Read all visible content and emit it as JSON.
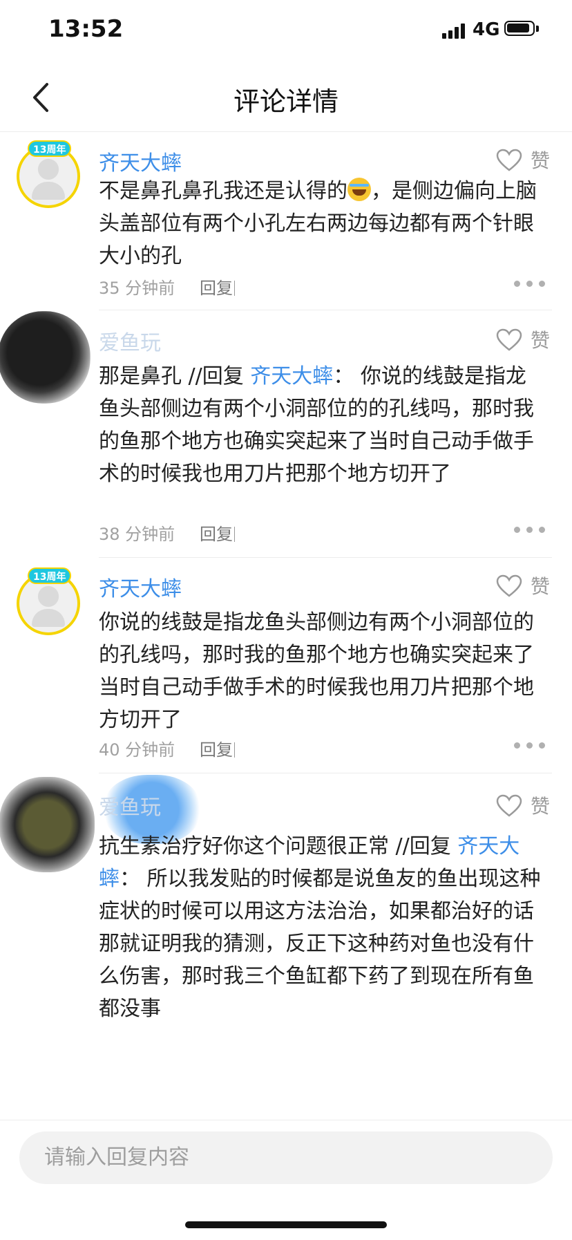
{
  "status_bar": {
    "time": "13:52",
    "network": "4G"
  },
  "nav": {
    "title": "评论详情",
    "back_icon": "chevron-left-icon"
  },
  "comments": [
    {
      "username": "齐天大蟀",
      "badge": "13周年",
      "content_before_emoji": "不是鼻孔鼻孔我还是认得的",
      "emoji": "tears-of-joy-emoji",
      "content_after_emoji": "，是侧边偏向上脑头盖部位有两个小孔左右两边每边都有两个针眼大小的孔",
      "time": "35 分钟前",
      "reply_label": "回复",
      "like_label": "赞"
    },
    {
      "username": "爱鱼玩",
      "content": "那是鼻孔 //回复 ",
      "mention": "齐天大蟀",
      "content_after": "： 你说的线鼓是指龙鱼头部侧边有两个小洞部位的的孔线吗，那时我的鱼那个地方也确实突起来了当时自己动手做手术的时候我也用刀片把那个地方切开了",
      "time": "38 分钟前",
      "reply_label": "回复",
      "like_label": "赞"
    },
    {
      "username": "齐天大蟀",
      "badge": "13周年",
      "content": "你说的线鼓是指龙鱼头部侧边有两个小洞部位的的孔线吗，那时我的鱼那个地方也确实突起来了当时自己动手做手术的时候我也用刀片把那个地方切开了",
      "time": "40 分钟前",
      "reply_label": "回复",
      "like_label": "赞"
    },
    {
      "username": "爱鱼玩",
      "content": "抗生素治疗好你这个问题很正常 //回复 ",
      "mention": "齐天大蟀",
      "content_after": "： 所以我发贴的时候都是说鱼友的鱼出现这种症状的时候可以用这方法治治，如果都治好的话那就证明我的猜测，反正下这种药对鱼也没有什么伤害，那时我三个鱼缸都下药了到现在所有鱼都没事",
      "like_label": "赞"
    }
  ],
  "reply_input": {
    "placeholder": "请输入回复内容",
    "value": ""
  },
  "colors": {
    "link_blue": "#3d8ee8",
    "ring_yellow": "#f5d400",
    "badge_cyan": "#1ec7e0"
  }
}
